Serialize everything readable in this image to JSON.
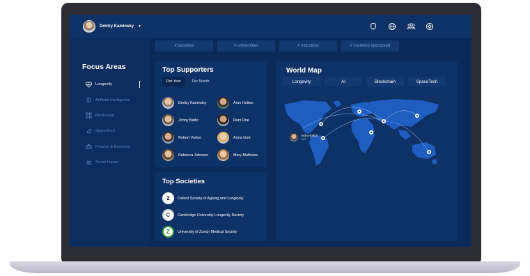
{
  "user": {
    "name": "Dmitry Kaminsky"
  },
  "header_icons": [
    "brain-icon",
    "globe-icon",
    "group-icon",
    "network-icon"
  ],
  "tags": [
    "# societies",
    "# universities",
    "# industries",
    "# societies sponsored"
  ],
  "focus_areas": {
    "title": "Focus Areas",
    "items": [
      {
        "label": "Longevity",
        "icon": "heart-pulse-icon"
      },
      {
        "label": "Artificial Intelligence",
        "icon": "brain-icon"
      },
      {
        "label": "Blockchain",
        "icon": "blockchain-icon"
      },
      {
        "label": "SpaceTech",
        "icon": "rocket-icon"
      },
      {
        "label": "Finance & Business",
        "icon": "briefcase-icon"
      },
      {
        "label": "Social Impact",
        "icon": "people-icon"
      }
    ]
  },
  "top_supporters": {
    "title": "Top Supporters",
    "filters": [
      "Per Year",
      "Per Month"
    ],
    "people": [
      {
        "name": "Dmitry Kaminsky",
        "color": "#b9a593"
      },
      {
        "name": "Aron Holton",
        "color": "#6f5b4a"
      },
      {
        "name": "Johny Baltic",
        "color": "#9c8c7c"
      },
      {
        "name": "Roni Doe",
        "color": "#7a6252"
      },
      {
        "name": "Robert Verton",
        "color": "#8c6f5a"
      },
      {
        "name": "Anna Gort",
        "color": "#d7b58d"
      },
      {
        "name": "Rebecca Johnson",
        "color": "#a9876c"
      },
      {
        "name": "Mary Mathews",
        "color": "#c79a6e"
      }
    ]
  },
  "top_societies": {
    "title": "Top Societies",
    "items": [
      {
        "name": "Oxford Society of Ageing and Longevity",
        "logo": "2"
      },
      {
        "name": "Cambridge University Longevity Society",
        "logo": "C"
      },
      {
        "name": "University of Zurich Medical Society",
        "logo": "Z"
      }
    ]
  },
  "world_map": {
    "title": "World Map",
    "tabs": [
      "Longevity",
      "AI",
      "Blockchain",
      "SpaceTech"
    ],
    "pin": {
      "name": "Aron Holton",
      "location": "USA"
    }
  },
  "colors": {
    "background": "#0b2a5a",
    "card": "#0f3266",
    "accent": "#5f85c0",
    "map_land": "#1f5dc0"
  }
}
